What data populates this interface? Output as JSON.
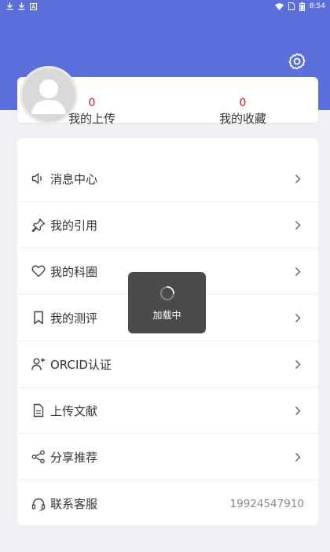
{
  "status_bar": {
    "time": "8:54",
    "icons_left": [
      "download-icon",
      "download-icon",
      "app-notification-icon"
    ],
    "icons_right": [
      "wifi-icon",
      "sim-icon",
      "battery-icon"
    ]
  },
  "colors": {
    "header": "#5b6fdc",
    "count": "#d02020",
    "background": "#eef0f5"
  },
  "profile": {
    "stats": [
      {
        "count": "0",
        "label": "我的上传"
      },
      {
        "count": "0",
        "label": "我的收藏"
      }
    ]
  },
  "menu": {
    "items": [
      {
        "label": "消息中心",
        "icon": "speaker-icon"
      },
      {
        "label": "我的引用",
        "icon": "pin-icon"
      },
      {
        "label": "我的科圈",
        "icon": "heart-icon"
      },
      {
        "label": "我的测评",
        "icon": "bookmark-icon"
      },
      {
        "label": "ORCID认证",
        "icon": "add-user-icon"
      },
      {
        "label": "上传文献",
        "icon": "document-icon"
      },
      {
        "label": "分享推荐",
        "icon": "share-icon"
      },
      {
        "label": "联系客服",
        "icon": "headset-icon",
        "value": "19924547910"
      }
    ]
  },
  "toast": {
    "text": "加载中"
  }
}
